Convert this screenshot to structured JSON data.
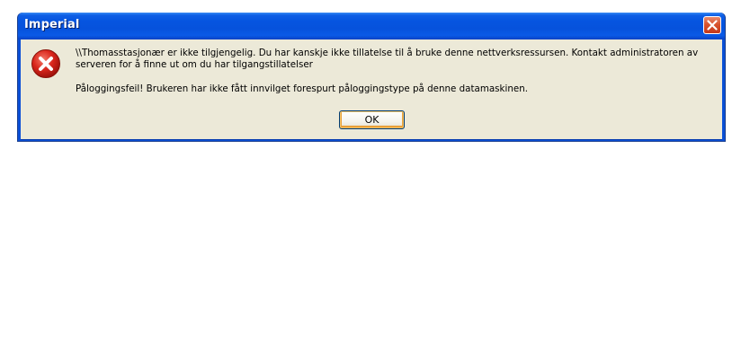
{
  "window": {
    "title": "Imperial",
    "close_icon": "close-icon"
  },
  "dialog": {
    "icon": "error-icon",
    "message_line1": "\\\\Thomasstasjonær er ikke tilgjengelig. Du har kanskje ikke tillatelse til å bruke denne nettverksressursen. Kontakt administratoren av serveren for å finne ut om du har tilgangstillatelser",
    "message_line2": "Påloggingsfeil!  Brukeren har ikke fått innvilget forespurt påloggingstype på denne datamaskinen.",
    "ok_label": "OK"
  },
  "colors": {
    "titlebar": "#0655e0",
    "client_bg": "#ece9d8",
    "error_red": "#d9261c",
    "close_red": "#d8532e"
  }
}
